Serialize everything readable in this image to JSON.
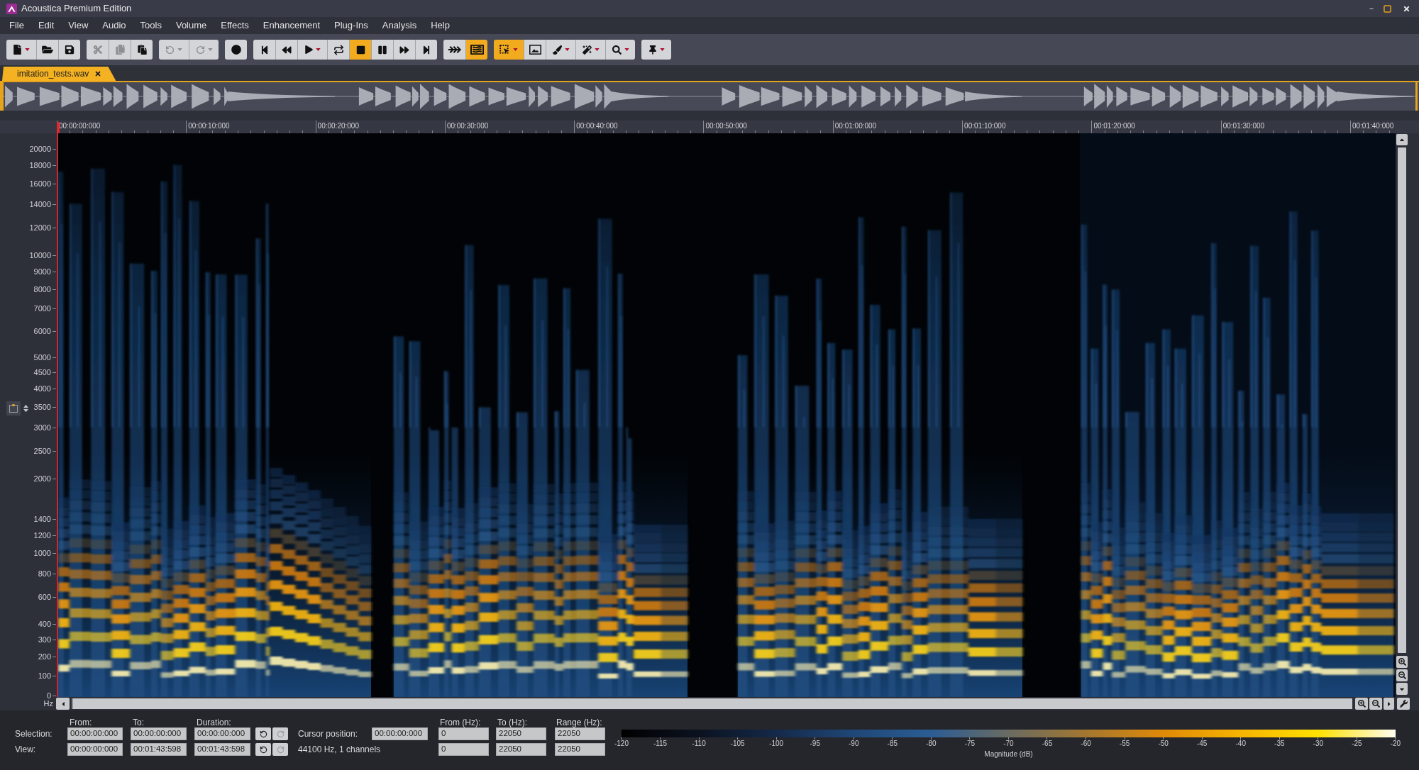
{
  "window": {
    "title": "Acoustica Premium Edition"
  },
  "menu": [
    "File",
    "Edit",
    "View",
    "Audio",
    "Tools",
    "Volume",
    "Effects",
    "Enhancement",
    "Plug-Ins",
    "Analysis",
    "Help"
  ],
  "toolbar": {
    "groups": [
      {
        "buttons": [
          {
            "kind": "new",
            "dropdown": true,
            "active": false,
            "disabled": false
          },
          {
            "kind": "open",
            "dropdown": false,
            "active": false,
            "disabled": false
          },
          {
            "kind": "save",
            "dropdown": false,
            "active": false,
            "disabled": false
          }
        ]
      },
      {
        "buttons": [
          {
            "kind": "cut",
            "dropdown": false,
            "active": false,
            "disabled": true
          },
          {
            "kind": "copy",
            "dropdown": false,
            "active": false,
            "disabled": true
          },
          {
            "kind": "paste",
            "dropdown": false,
            "active": false,
            "disabled": false
          }
        ]
      },
      {
        "buttons": [
          {
            "kind": "undo",
            "dropdown": true,
            "active": false,
            "disabled": true
          },
          {
            "kind": "redo",
            "dropdown": true,
            "active": false,
            "disabled": true
          }
        ]
      },
      {
        "buttons": [
          {
            "kind": "record",
            "dropdown": false,
            "active": false,
            "disabled": false
          }
        ]
      },
      {
        "buttons": [
          {
            "kind": "start",
            "dropdown": false,
            "active": false,
            "disabled": false
          },
          {
            "kind": "rewind",
            "dropdown": false,
            "active": false,
            "disabled": false
          },
          {
            "kind": "play",
            "dropdown": true,
            "active": false,
            "disabled": false
          },
          {
            "kind": "loop",
            "dropdown": false,
            "active": false,
            "disabled": false
          },
          {
            "kind": "stop",
            "dropdown": false,
            "active": true,
            "disabled": false
          },
          {
            "kind": "pause",
            "dropdown": false,
            "active": false,
            "disabled": false
          },
          {
            "kind": "forward",
            "dropdown": false,
            "active": false,
            "disabled": false
          },
          {
            "kind": "end",
            "dropdown": false,
            "active": false,
            "disabled": false
          }
        ]
      },
      {
        "buttons": [
          {
            "kind": "scrub",
            "dropdown": false,
            "active": false,
            "disabled": false
          },
          {
            "kind": "spectrum",
            "dropdown": false,
            "active": true,
            "disabled": false
          }
        ]
      },
      {
        "buttons": [
          {
            "kind": "select",
            "dropdown": true,
            "active": true,
            "disabled": false
          },
          {
            "kind": "frame",
            "dropdown": false,
            "active": false,
            "disabled": false
          },
          {
            "kind": "brush",
            "dropdown": true,
            "active": false,
            "disabled": false
          },
          {
            "kind": "wand",
            "dropdown": true,
            "active": false,
            "disabled": false
          },
          {
            "kind": "zoom",
            "dropdown": true,
            "active": false,
            "disabled": false
          }
        ]
      },
      {
        "buttons": [
          {
            "kind": "pin",
            "dropdown": true,
            "active": false,
            "disabled": false
          }
        ]
      }
    ]
  },
  "tabs": [
    {
      "label": "imitation_tests.wav",
      "selected": true
    }
  ],
  "time_ruler": {
    "labels": [
      "00:00:00:000",
      "00:00:10:000",
      "00:00:20:000",
      "00:00:30:000",
      "00:00:40:000",
      "00:00:50:000",
      "00:01:00:000",
      "00:01:10:000",
      "00:01:20:000",
      "00:01:30:000",
      "00:01:40:000"
    ]
  },
  "frequency_axis": {
    "unit": "Hz",
    "labels": [
      "20000",
      "18000",
      "16000",
      "14000",
      "12000",
      "10000",
      "9000",
      "8000",
      "7000",
      "6000",
      "5000",
      "4500",
      "4000",
      "3500",
      "3000",
      "2500",
      "2000",
      "1400",
      "1200",
      "1000",
      "800",
      "600",
      "400",
      "300",
      "200",
      "100",
      "0"
    ]
  },
  "selection_panel": {
    "columns": [
      "From:",
      "To:",
      "Duration:"
    ],
    "rows": [
      {
        "label": "Selection:",
        "values": [
          "00:00:00:000",
          "00:00:00:000",
          "00:00:00:000"
        ],
        "history": [
          {
            "kind": "undo",
            "disabled": false
          },
          {
            "kind": "redo",
            "disabled": true
          }
        ]
      },
      {
        "label": "View:",
        "values": [
          "00:00:00:000",
          "00:01:43:598",
          "00:01:43:598"
        ],
        "history": [
          {
            "kind": "undo",
            "disabled": false
          },
          {
            "kind": "redo",
            "disabled": true
          }
        ]
      }
    ],
    "cursor": {
      "label": "Cursor position:",
      "value": "00:00:00:000"
    },
    "format": "44100 Hz, 1 channels"
  },
  "frequency_panel": {
    "columns": [
      "From (Hz):",
      "To (Hz):",
      "Range (Hz):"
    ],
    "rows": [
      [
        "0",
        "22050",
        "22050"
      ],
      [
        "0",
        "22050",
        "22050"
      ]
    ]
  },
  "color_scale": {
    "ticks": [
      "-120",
      "-115",
      "-110",
      "-105",
      "-100",
      "-95",
      "-90",
      "-85",
      "-80",
      "-75",
      "-70",
      "-65",
      "-60",
      "-55",
      "-50",
      "-45",
      "-40",
      "-35",
      "-30",
      "-25",
      "-20"
    ],
    "title": "Magnitude (dB)"
  }
}
